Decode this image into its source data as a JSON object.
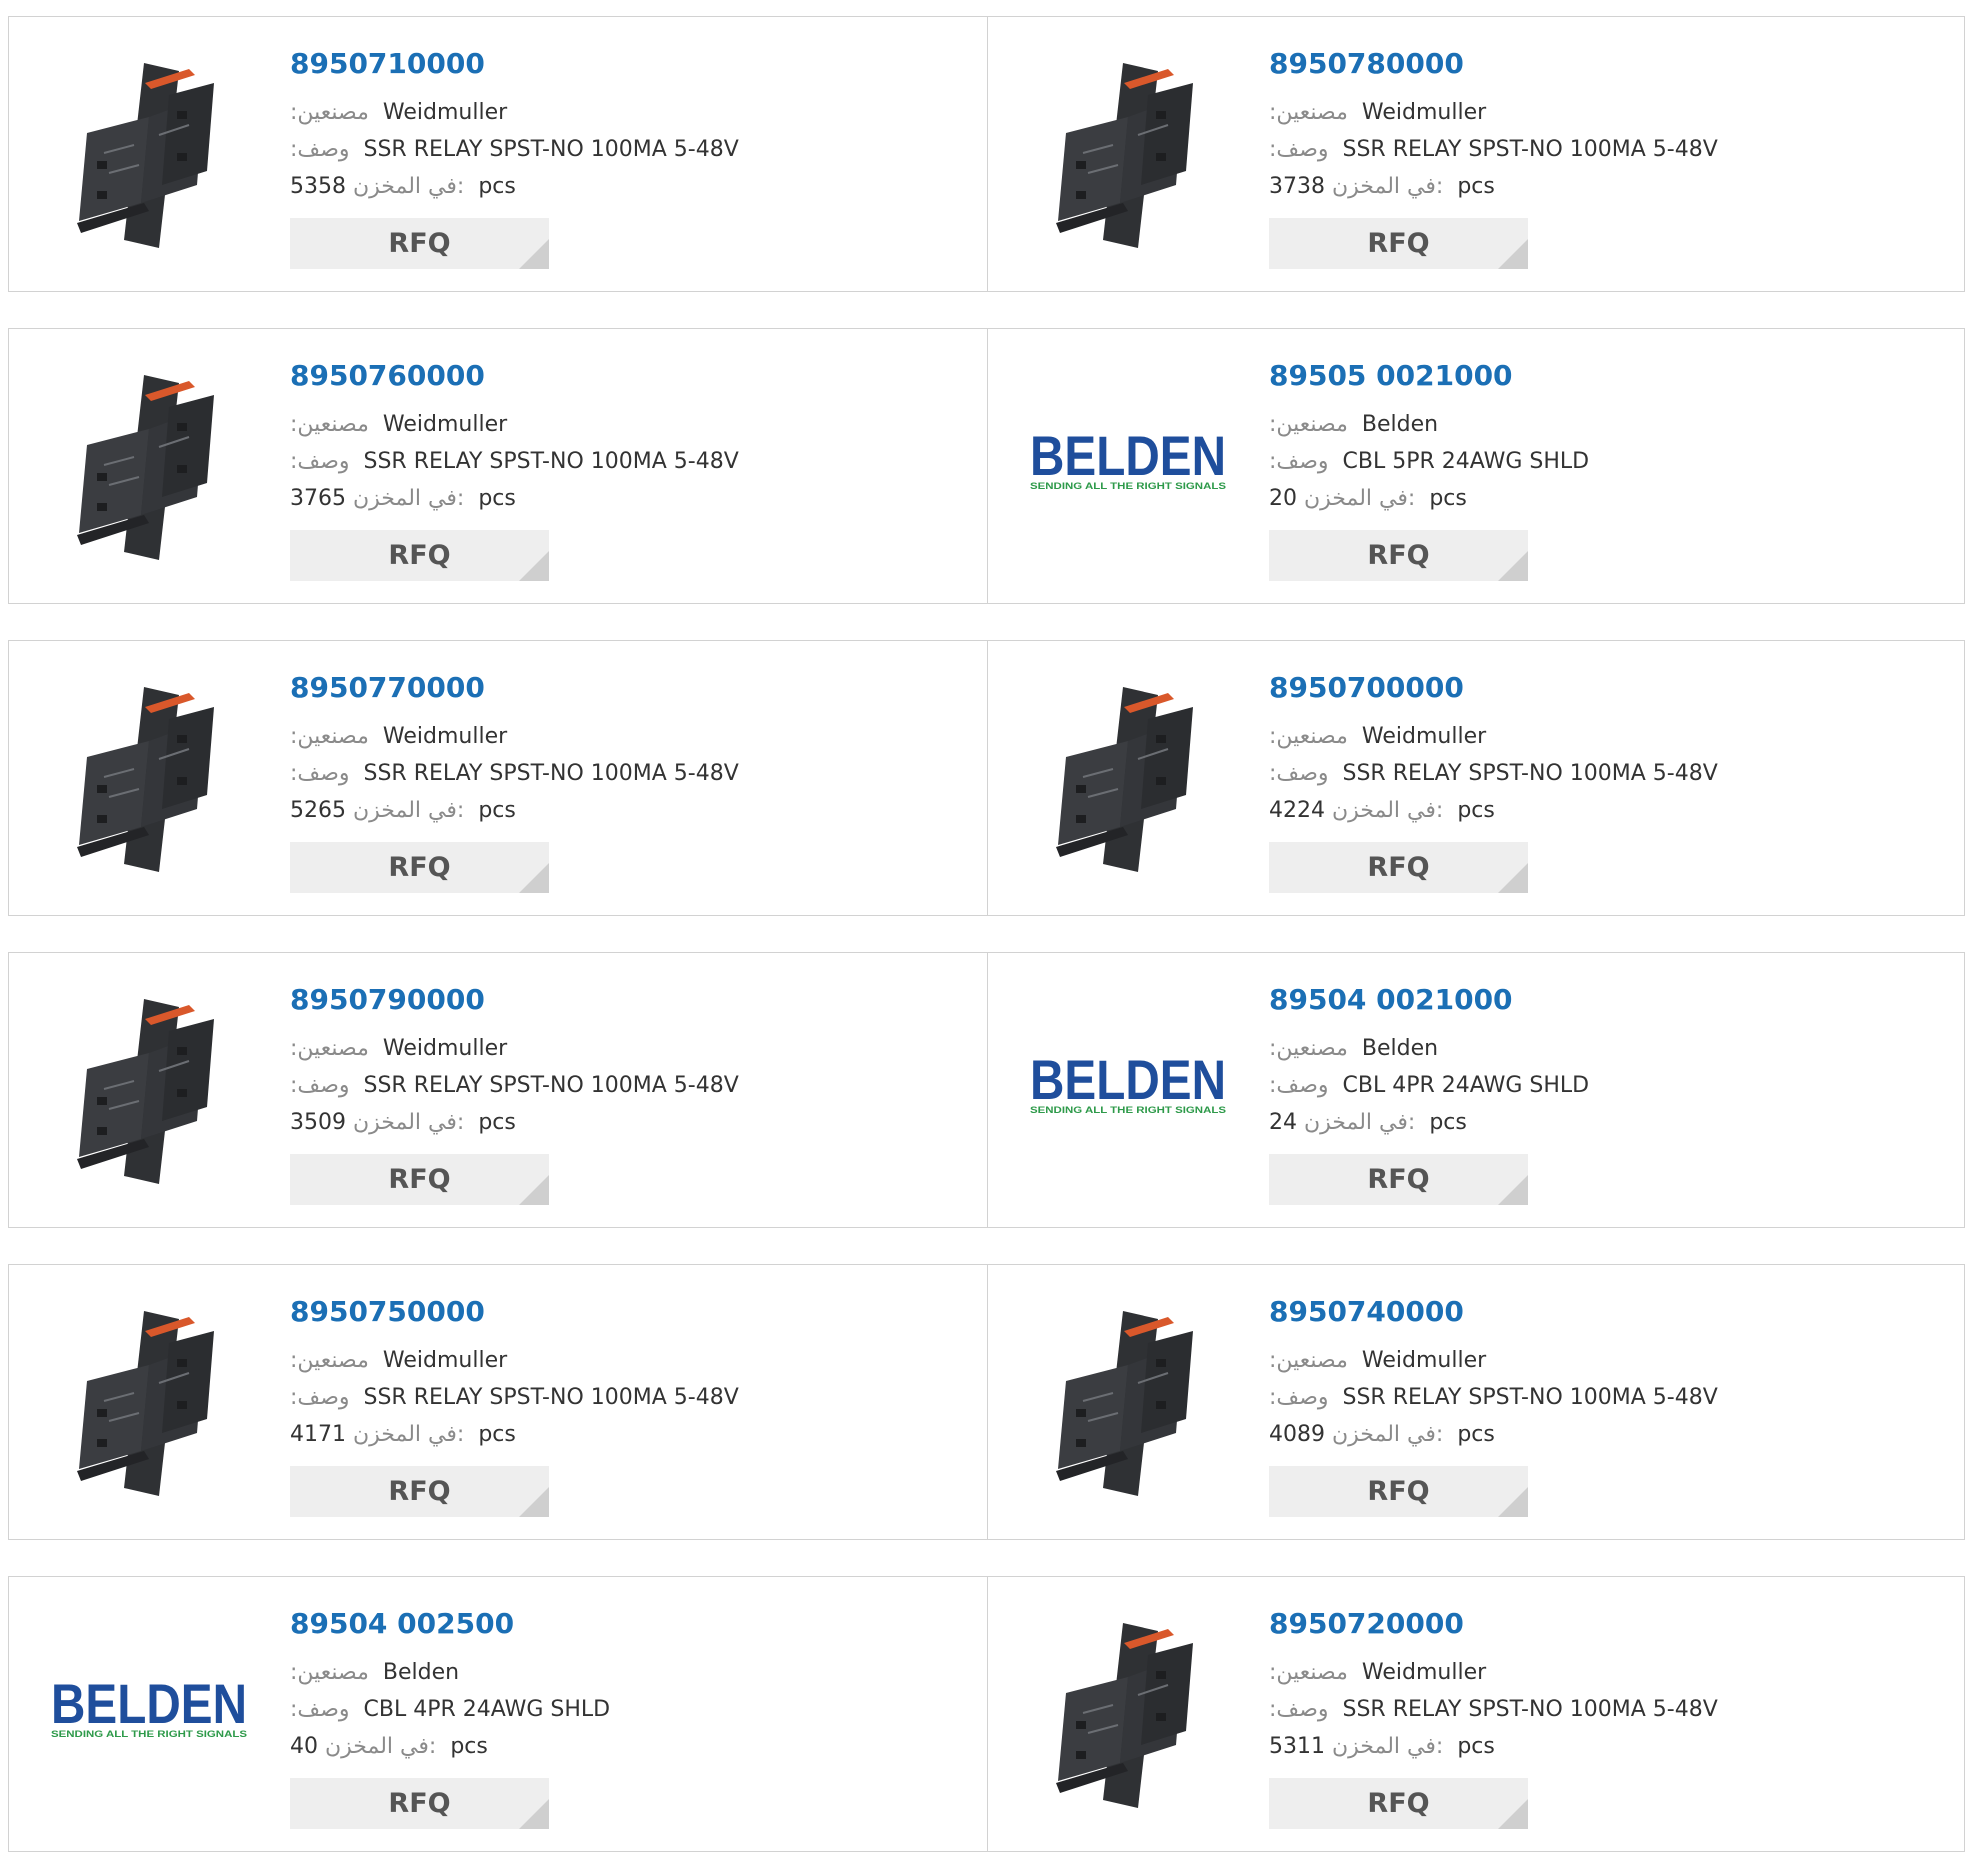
{
  "labels": {
    "manufacturer": ":مصنعين",
    "description": ":وصف",
    "stock": "في المخزن:",
    "unit": "pcs",
    "rfq": "RFQ"
  },
  "products": [
    {
      "part": "8950710000",
      "brand": "Weidmuller",
      "desc": "SSR RELAY SPST-NO 100MA 5-48V",
      "stock": "5358",
      "image": "relay-module-image"
    },
    {
      "part": "8950780000",
      "brand": "Weidmuller",
      "desc": "SSR RELAY SPST-NO 100MA 5-48V",
      "stock": "3738",
      "image": "relay-module-image"
    },
    {
      "part": "8950760000",
      "brand": "Weidmuller",
      "desc": "SSR RELAY SPST-NO 100MA 5-48V",
      "stock": "3765",
      "image": "relay-module-image"
    },
    {
      "part": "89505 0021000",
      "brand": "Belden",
      "desc": "CBL 5PR 24AWG SHLD",
      "stock": "20",
      "image": "belden-logo",
      "logo_text": "BELDEN",
      "logo_tagline": "SENDING ALL THE RIGHT SIGNALS"
    },
    {
      "part": "8950770000",
      "brand": "Weidmuller",
      "desc": "SSR RELAY SPST-NO 100MA 5-48V",
      "stock": "5265",
      "image": "relay-module-image"
    },
    {
      "part": "8950700000",
      "brand": "Weidmuller",
      "desc": "SSR RELAY SPST-NO 100MA 5-48V",
      "stock": "4224",
      "image": "relay-module-image"
    },
    {
      "part": "8950790000",
      "brand": "Weidmuller",
      "desc": "SSR RELAY SPST-NO 100MA 5-48V",
      "stock": "3509",
      "image": "relay-module-image"
    },
    {
      "part": "89504 0021000",
      "brand": "Belden",
      "desc": "CBL 4PR 24AWG SHLD",
      "stock": "24",
      "image": "belden-logo",
      "logo_text": "BELDEN",
      "logo_tagline": "SENDING ALL THE RIGHT SIGNALS"
    },
    {
      "part": "8950750000",
      "brand": "Weidmuller",
      "desc": "SSR RELAY SPST-NO 100MA 5-48V",
      "stock": "4171",
      "image": "relay-module-image"
    },
    {
      "part": "8950740000",
      "brand": "Weidmuller",
      "desc": "SSR RELAY SPST-NO 100MA 5-48V",
      "stock": "4089",
      "image": "relay-module-image"
    },
    {
      "part": "89504 002500",
      "brand": "Belden",
      "desc": "CBL 4PR 24AWG SHLD",
      "stock": "40",
      "image": "belden-logo",
      "logo_text": "BELDEN",
      "logo_tagline": "SENDING ALL THE RIGHT SIGNALS"
    },
    {
      "part": "8950720000",
      "brand": "Weidmuller",
      "desc": "SSR RELAY SPST-NO 100MA 5-48V",
      "stock": "5311",
      "image": "relay-module-image"
    }
  ],
  "colors": {
    "part_link": "#1b6fb5",
    "label": "#8a8a8a",
    "border": "#d2d2d2",
    "rfq_bg": "#eeeeee",
    "belden_blue": "#1f4e9c",
    "belden_green": "#2e9a4a",
    "relay_accent": "#d9582b"
  }
}
